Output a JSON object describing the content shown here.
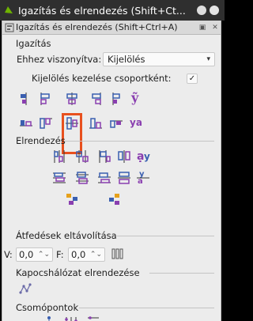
{
  "window": {
    "title": "Igazítás és elrendezés (Shift+Ct...",
    "tab_label": "Igazítás és elrendezés (Shift+Ctrl+A)"
  },
  "align": {
    "section_title": "Igazítás",
    "relative_label": "Ehhez viszonyítva:",
    "relative_value": "Kijelölés",
    "group_label": "Kijelölés kezelése csoportként:",
    "group_checked": "✓",
    "row1_icons": [
      "align-right-to-left-anchor-icon",
      "align-left-edges-icon",
      "center-on-vertical-axis-icon",
      "align-right-edges-icon",
      "align-left-to-right-anchor-icon",
      "align-baseline-text-icon"
    ],
    "row2_icons": [
      "align-bottom-to-top-anchor-icon",
      "align-top-edges-icon",
      "center-on-horizontal-axis-icon",
      "align-bottom-edges-icon",
      "align-top-to-bottom-anchor-icon",
      "align-baseline-anchors-icon"
    ]
  },
  "distribute": {
    "section_title": "Elrendezés"
  },
  "overlap": {
    "section_title": "Átfedések eltávolítása",
    "v_label": "V:",
    "v_value": "0,0",
    "h_label": "F:",
    "h_value": "0,0"
  },
  "connector": {
    "section_title": "Kapocshálózat elrendezése"
  },
  "nodes": {
    "section_title": "Csomópontok"
  },
  "colors": {
    "highlight": "#e8501e",
    "icon_blue": "#3a5fb0",
    "icon_purple": "#8a3fb0"
  }
}
